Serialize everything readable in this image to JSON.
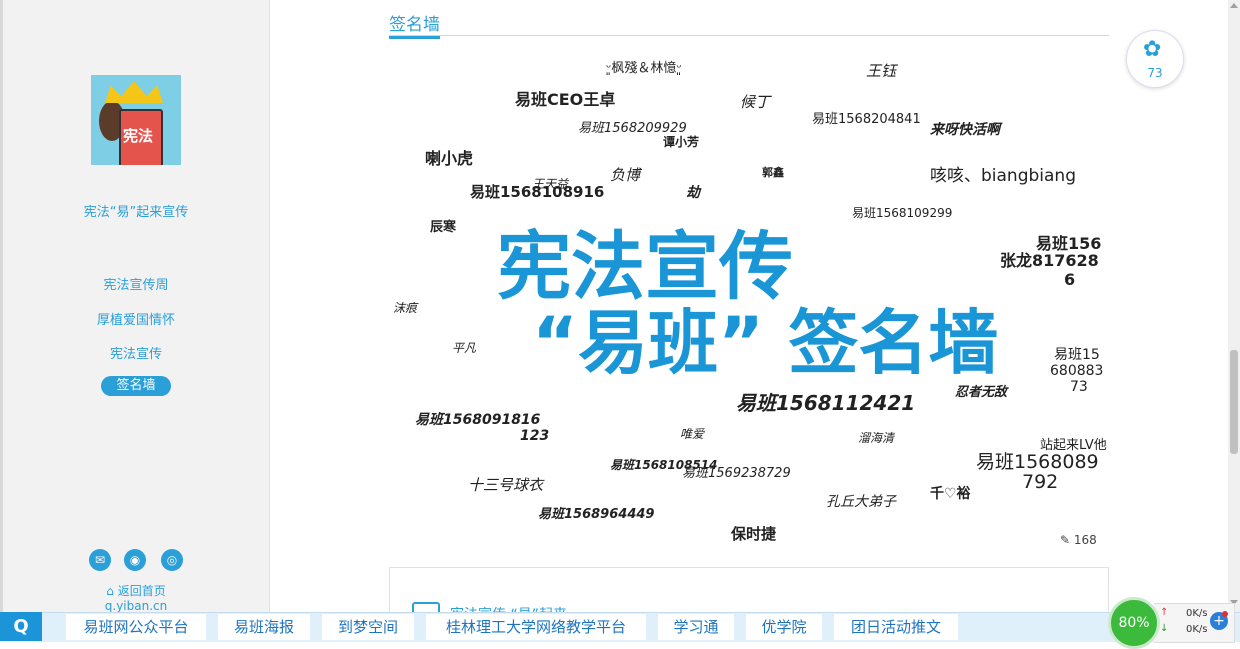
{
  "sidebar": {
    "avatar_text": "宪法",
    "site_title": "宪法“易”起来宣传",
    "nav": [
      "宪法宣传周",
      "厚植爱国情怀",
      "宪法宣传",
      "签名墙"
    ],
    "home_link": "返回首页",
    "domain": "q.yiban.cn"
  },
  "main": {
    "section_title": "签名墙",
    "wall_title_line1": "宪法宣传",
    "wall_title_line2": "“易班” 签名墙",
    "signatures": [
      "ᵕ͈枫殘＆林憶ᵕ͈",
      "王钰",
      "易班CEO王卓",
      "候丁",
      "易班1568209929",
      "易班1568204841",
      "来呀快活啊",
      "谭小芳",
      "喇小虎",
      "负博",
      "郭鑫",
      "咳咳、biangbiang",
      "王天益",
      "易班1568108916",
      "劫",
      "易班1568109299",
      "辰寒",
      "易班156",
      "张龙817628",
      "6",
      "沫痕",
      "平凡",
      "易班15",
      "680883",
      "73",
      "易班1568112421",
      "忍者无敌",
      "易班1568091816",
      "123",
      "唯爱",
      "溜海清",
      "站起来LV他",
      "易班1568089",
      "792",
      "易班1568108514",
      "易班1569238729",
      "十三号球衣",
      "千♡裕",
      "孔丘大弟子",
      "易班1568964449",
      "保时捷"
    ],
    "pen_count": "168",
    "card_text": "宪法宣传",
    "card_text2": "“易”起来"
  },
  "like": {
    "count": "73"
  },
  "bottom_bar": {
    "links": [
      "易班网公众平台",
      "易班海报",
      "到梦空间",
      "桂林理工大学网络教学平台",
      "学习通",
      "优学院",
      "团日活动推文"
    ]
  },
  "net": {
    "percent": "80%",
    "up": "0K/s",
    "down": "0K/s"
  },
  "colors": {
    "accent": "#1a96d6",
    "active_nav": "#2a9fd8"
  }
}
